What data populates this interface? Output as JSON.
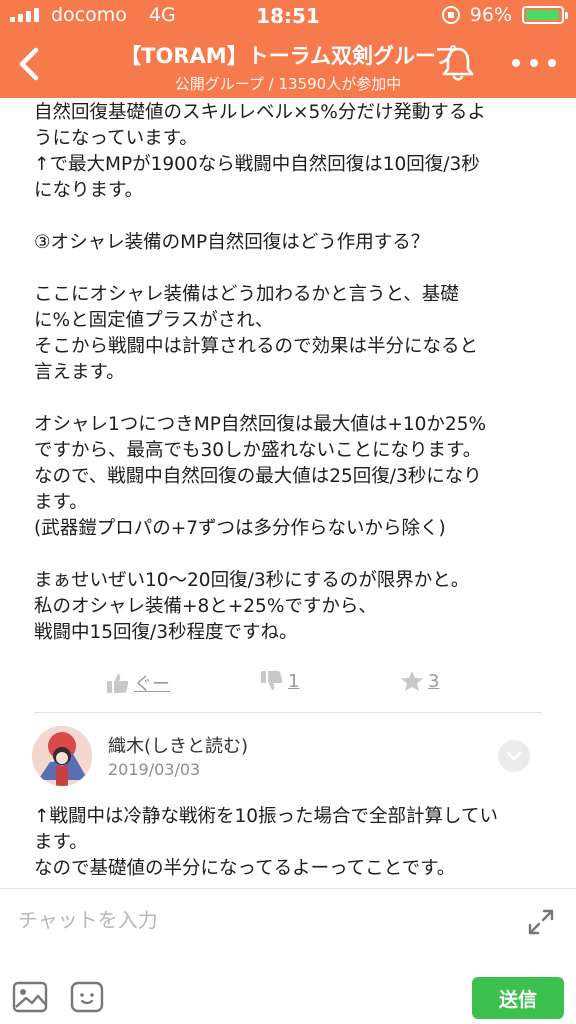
{
  "status_bar": {
    "carrier": "docomo",
    "network": "4G",
    "time": "18:51",
    "battery": "96%",
    "battery_level": 0.96,
    "signal_bars": 4
  },
  "header": {
    "title": "【TORAM】トーラム双剣グループ",
    "subtitle": "公開グループ / 13590人が参加中",
    "bg_color": "#f77a4c"
  },
  "post": {
    "lines": [
      "自然回復基礎値のスキルレベル×5%分だけ発動するよ",
      "うになっています。",
      "↑で最大MPが1900なら戦闘中自然回復は10回復/3秒",
      "になります。",
      "",
      "③オシャレ装備のMP自然回復はどう作用する？",
      "",
      "ここにオシャレ装備はどう加わるかと言うと、基礎",
      "に%と固定値プラスがされ、",
      "そこから戦闘中は計算されるので効果は半分になると",
      "言えます。",
      "",
      "オシャレ1つにつきMP自然回復は最大値は+10か25%",
      "ですから、最高でも30しか盛れないことになります。",
      "なので、戦闘中自然回復の最大値は25回復/3秒になり",
      "ます。",
      "(武器鎧プロパの+7ずつは多分作らないから除く)",
      "",
      "まぁせいぜい10〜20回復/3秒にするのが限界かと。",
      "私のオシャレ装備+8と+25%ですから、",
      "戦闘中15回復/3秒程度ですね。"
    ],
    "actions": {
      "like_label": "ぐー",
      "dislike_count": "1",
      "star_count": "3"
    }
  },
  "reply": {
    "author": "織木(しきと読む)",
    "date": "2019/03/03",
    "lines": [
      "↑戦闘中は冷静な戦術を10振った場合で全部計算してい",
      "ます。",
      "なので基礎値の半分になってるよーってことです。"
    ]
  },
  "input_bar": {
    "placeholder": "チャットを入力",
    "send_label": "送信",
    "send_color": "#3cc04e"
  }
}
